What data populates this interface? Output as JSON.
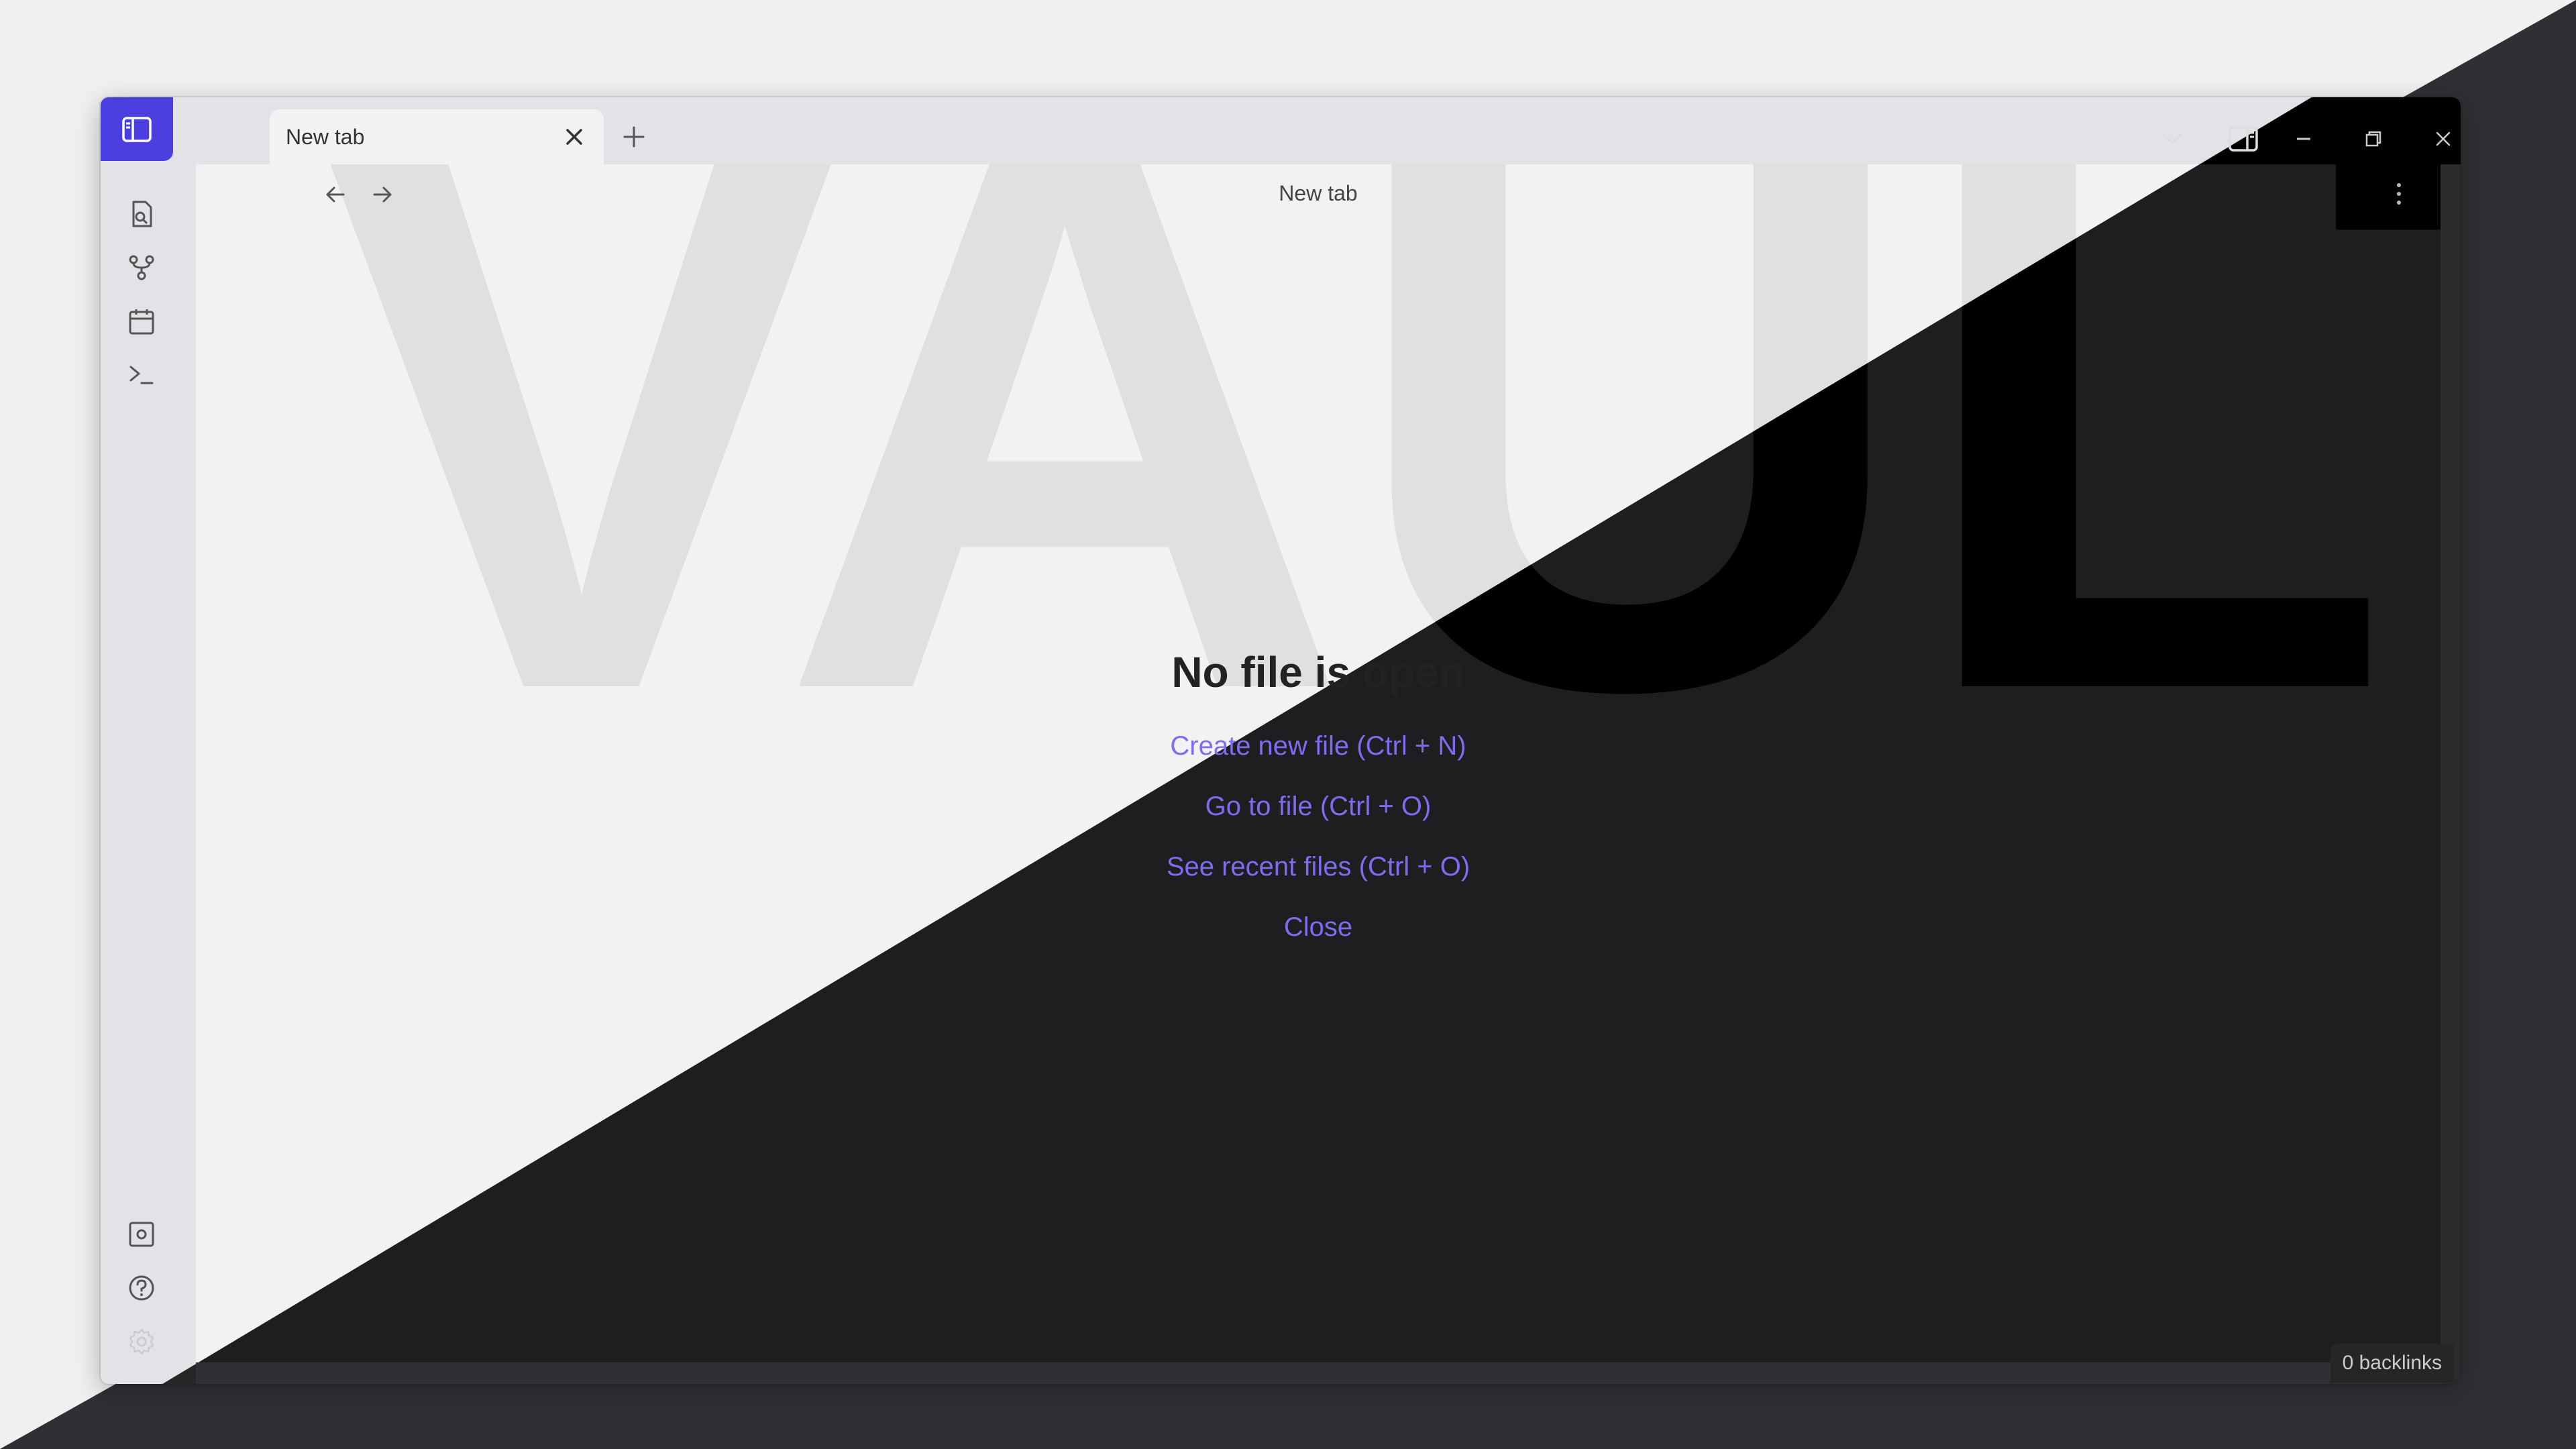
{
  "window": {
    "tab": {
      "title": "New tab"
    }
  },
  "view": {
    "title": "New tab"
  },
  "watermark": "VAULT",
  "empty_state": {
    "heading": "No file is open",
    "actions": [
      {
        "label": "Create new file (Ctrl + N)"
      },
      {
        "label": "Go to file (Ctrl + O)"
      },
      {
        "label": "See recent files (Ctrl + O)"
      },
      {
        "label": "Close"
      }
    ]
  },
  "ribbon": {
    "top": [
      "open-quick-switcher-icon",
      "graph-view-icon",
      "daily-note-icon",
      "command-palette-icon"
    ],
    "bottom": [
      "vault-switcher-icon",
      "help-icon",
      "settings-icon"
    ]
  },
  "status": {
    "backlinks": "0 backlinks"
  },
  "colors": {
    "accent": "#4c3fe0",
    "link": "#7b6cf0",
    "light_bg": "#f2f2f2",
    "dark_bg": "#1e1e20"
  }
}
